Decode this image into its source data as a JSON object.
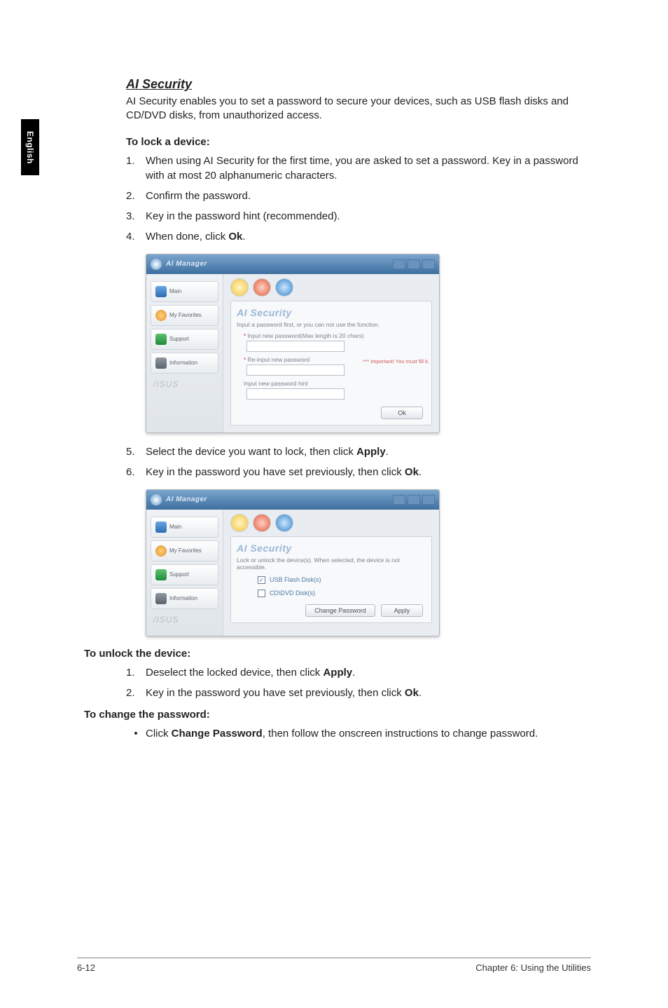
{
  "side_tab": "English",
  "title": "AI Security",
  "intro": "AI Security enables you to set a password to secure your devices, such as USB flash disks and CD/DVD disks, from unauthorized access.",
  "lock_heading": "To lock a device:",
  "lock_steps": [
    {
      "num": "1.",
      "text_before": "When using AI Security for the first time, you are asked to set a password. Key in a password with at most 20 alphanumeric characters."
    },
    {
      "num": "2.",
      "text_before": "Confirm the password."
    },
    {
      "num": "3.",
      "text_before": "Key in the password hint (recommended)."
    },
    {
      "num": "4.",
      "text_before": "When done, click ",
      "bold": "Ok",
      "text_after": "."
    },
    {
      "num": "5.",
      "text_before": "Select the device you want to lock, then click ",
      "bold": "Apply",
      "text_after": "."
    },
    {
      "num": "6.",
      "text_before": "Key in the password you have set previously, then click ",
      "bold": "Ok",
      "text_after": "."
    }
  ],
  "unlock_heading": "To unlock the device:",
  "unlock_steps": [
    {
      "num": "1.",
      "text_before": "Deselect the locked device, then click ",
      "bold": "Apply",
      "text_after": "."
    },
    {
      "num": "2.",
      "text_before": "Key in the password you have set previously, then click ",
      "bold": "Ok",
      "text_after": "."
    }
  ],
  "change_heading": "To change the password:",
  "change_bullet": {
    "bullet": "•",
    "text_before": "Click ",
    "bold": "Change Password",
    "text_after": ", then follow the onscreen instructions to change password."
  },
  "window1": {
    "title": "AI Manager",
    "sidebar": {
      "items": [
        "Main",
        "My Favorites",
        "Support",
        "Information"
      ],
      "brand": "/ISUS"
    },
    "panel_title": "AI Security",
    "hint": "Input a password first, or you can not use the function.",
    "row1": "Input new password(Max length is 20 chars)",
    "row2": "Re-input new password",
    "row3": "Input new password hint",
    "side_note": "*** Important! You must fill it.",
    "ok_btn": "Ok"
  },
  "window2": {
    "title": "AI Manager",
    "sidebar": {
      "items": [
        "Main",
        "My Favorites",
        "Support",
        "Information"
      ],
      "brand": "/ISUS"
    },
    "panel_title": "AI Security",
    "hint": "Lock or unlock the device(s). When selected, the device is not accessible.",
    "chk1": "USB Flash Disk(s)",
    "chk2": "CD\\DVD Disk(s)",
    "change_btn": "Change Password",
    "apply_btn": "Apply"
  },
  "footer": {
    "left": "6-12",
    "right": "Chapter 6: Using the Utilities"
  }
}
